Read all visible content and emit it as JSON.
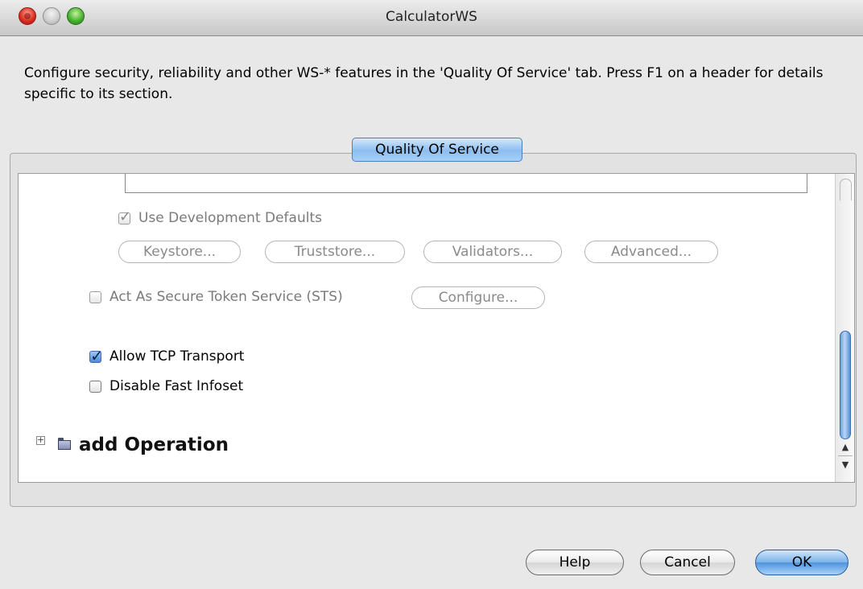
{
  "window": {
    "title": "CalculatorWS"
  },
  "description": "Configure security, reliability and other WS-* features in the 'Quality Of Service' tab. Press F1 on a header for details specific to its section.",
  "tabs": [
    {
      "label": "Quality Of Service",
      "selected": true
    }
  ],
  "qos": {
    "use_dev_defaults": {
      "label": "Use Development Defaults",
      "checked": true,
      "enabled": false
    },
    "store_buttons": [
      {
        "label": "Keystore...",
        "enabled": false
      },
      {
        "label": "Truststore...",
        "enabled": false
      },
      {
        "label": "Validators...",
        "enabled": false
      },
      {
        "label": "Advanced...",
        "enabled": false
      }
    ],
    "sts": {
      "label": "Act As Secure Token Service (STS)",
      "checked": false,
      "enabled": false,
      "configure_label": "Configure..."
    },
    "allow_tcp": {
      "label": "Allow TCP Transport",
      "checked": true
    },
    "disable_fast_infoset": {
      "label": "Disable Fast Infoset",
      "checked": false
    },
    "tree": {
      "expander": "+",
      "operation_label": "add Operation",
      "icon": "folder-icon"
    }
  },
  "scrollbar": {
    "up_arrow": "▲",
    "down_arrow": "▼"
  },
  "footer": {
    "help_label": "Help",
    "cancel_label": "Cancel",
    "ok_label": "OK"
  },
  "colors": {
    "accent": "#5a8fd6",
    "tab_active": "#8cbdf0",
    "disabled_text": "#7a7a7a"
  }
}
